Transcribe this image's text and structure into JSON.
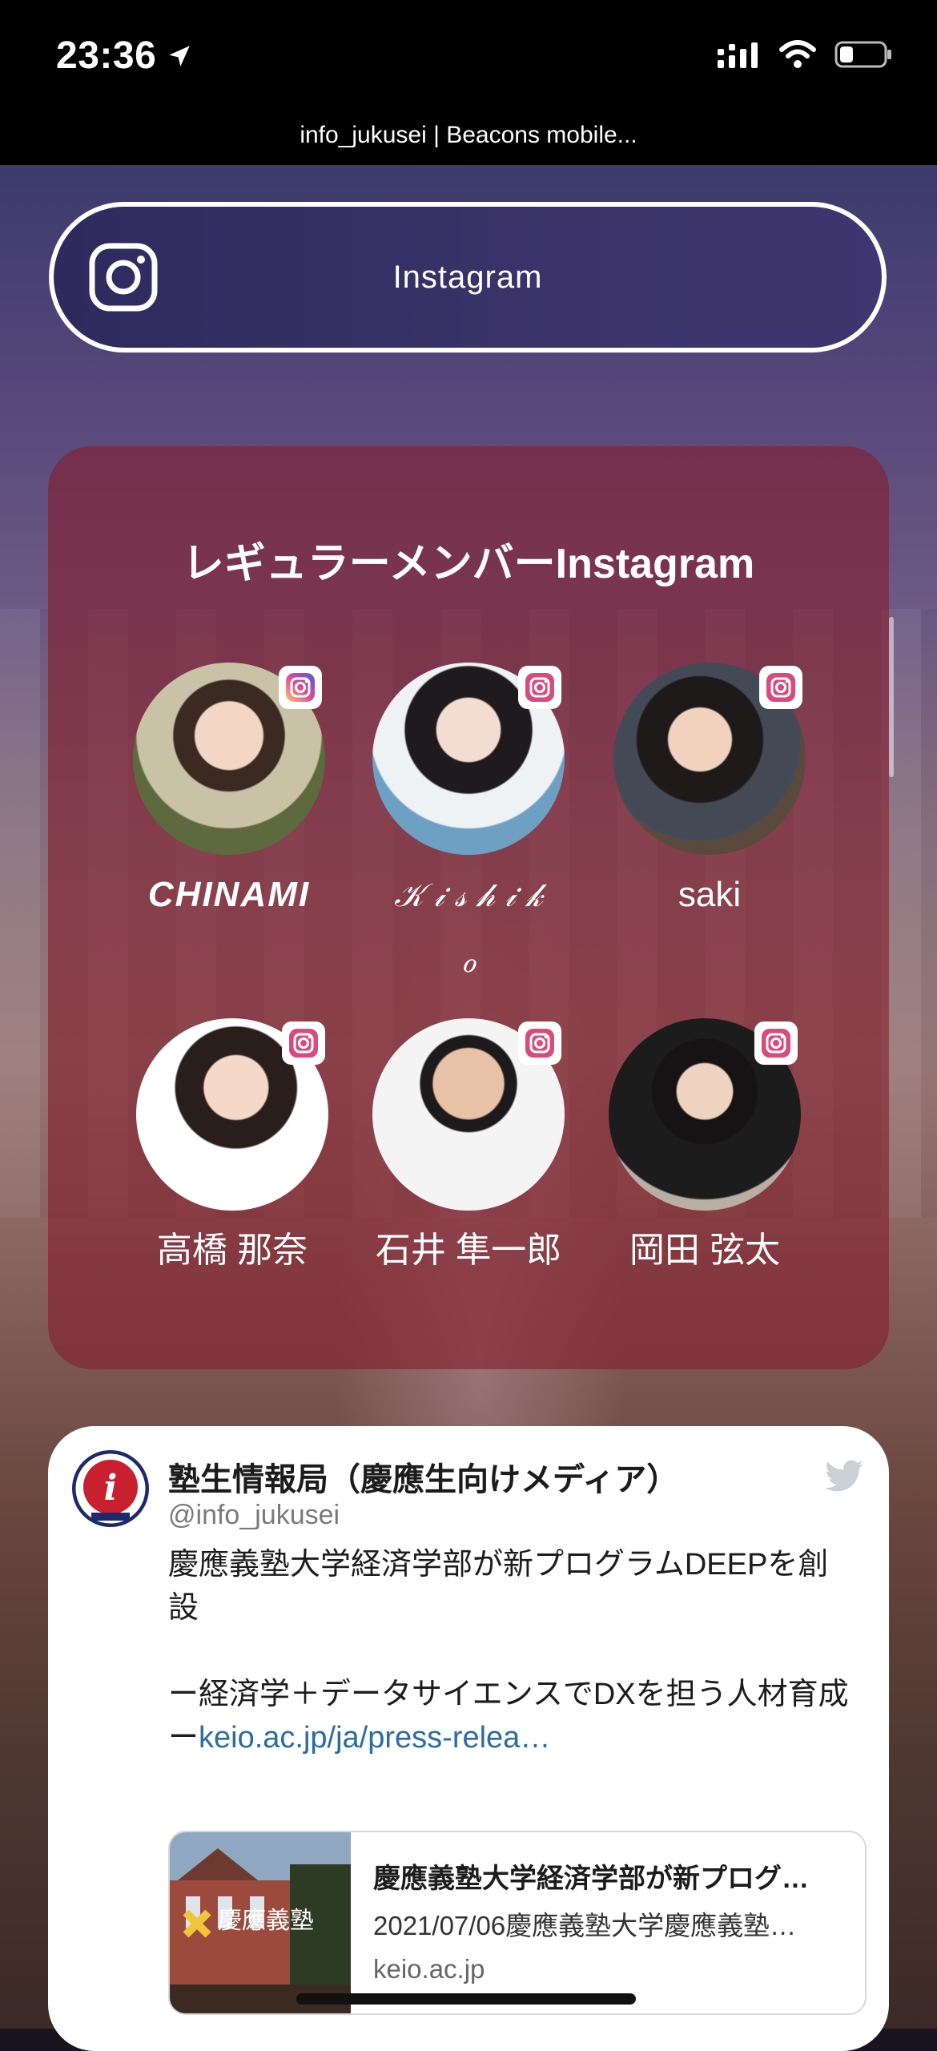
{
  "status_bar": {
    "time": "23:36",
    "page_title": "info_jukusei | Beacons mobile..."
  },
  "instagram_button": {
    "label": "Instagram",
    "icon": "instagram-icon"
  },
  "members": {
    "title": "レギュラーメンバーInstagram",
    "items": [
      {
        "name_line1": "CHINAMI",
        "name_line2": ""
      },
      {
        "name_line1": "𝒦 𝒾 𝓈 𝒽 𝒾 𝓀",
        "name_line2": "ℴ"
      },
      {
        "name_line1": "saki",
        "name_line2": ""
      },
      {
        "name_line1": "高橋 那奈",
        "name_line2": ""
      },
      {
        "name_line1": "石井 隼一郎",
        "name_line2": ""
      },
      {
        "name_line1": "岡田 弦太",
        "name_line2": ""
      }
    ]
  },
  "tweet": {
    "name": "塾生情報局（慶應生向けメディア）",
    "handle": "@info_jukusei",
    "text_line1": "慶應義塾大学経済学部が新プログラムDEEPを創設",
    "text_line2": "ー経済学＋データサイエンスでDXを担う人材育成ー",
    "link": "keio.ac.jp/ja/press-relea…",
    "preview": {
      "title": "慶應義塾大学経済学部が新プログ…",
      "description": "2021/07/06慶應義塾大学慶應義塾…",
      "domain": "keio.ac.jp",
      "image_text": "慶應義塾"
    }
  },
  "colors": {
    "card_red": "#82202d",
    "button_navy": "#2e2a5e",
    "link_blue": "#2b6ca3",
    "twitter_gray": "#c9d0d6"
  }
}
